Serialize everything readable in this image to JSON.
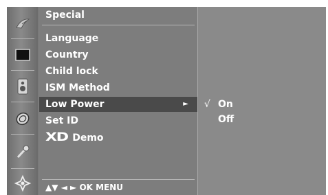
{
  "menu": {
    "title": "Special",
    "items": [
      {
        "label": "Language"
      },
      {
        "label": "Country"
      },
      {
        "label": "Child lock"
      },
      {
        "label": "ISM Method"
      },
      {
        "label": "Low Power",
        "arrow": "►"
      },
      {
        "label": "Set ID"
      },
      {
        "logo": "XD",
        "label": "Demo"
      }
    ],
    "footer": "▲▼  ◄ ►  OK  MENU"
  },
  "submenu": {
    "check_mark": "√",
    "options": [
      {
        "label": "On",
        "checked": true
      },
      {
        "label": "Off",
        "checked": false
      }
    ]
  },
  "sidebar": {
    "icons": [
      "satellite-dish-icon",
      "picture-icon",
      "speaker-icon",
      "clock-icon",
      "wrench-icon",
      "special-settings-icon"
    ]
  },
  "colors": {
    "panel_bg": "#7d7d7d",
    "selected_bg": "#4a4a4a",
    "text": "#ffffff"
  }
}
